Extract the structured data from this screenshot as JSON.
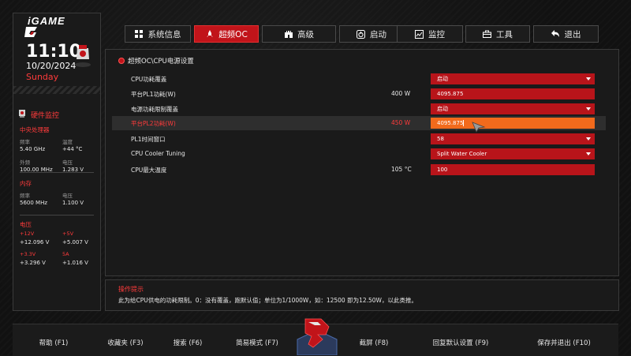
{
  "brand": "iGAME",
  "clock": {
    "time": "11:10",
    "date": "10/20/2024",
    "weekday": "Sunday"
  },
  "hardware": {
    "title": "硬件监控",
    "cpu": {
      "title": "中央处理器",
      "freq_label": "频率",
      "freq": "5.40 GHz",
      "temp_label": "温度",
      "temp": "+44 °C",
      "ext_freq_label": "外频",
      "ext_freq": "100.00 MHz",
      "voltage_label": "电压",
      "voltage": "1.283 V"
    },
    "memory": {
      "title": "内存",
      "freq_label": "频率",
      "freq": "5600 MHz",
      "voltage_label": "电压",
      "voltage": "1.100 V"
    },
    "power": {
      "title": "电压",
      "v12_label": "+12V",
      "v12": "+12.096 V",
      "v5_label": "+5V",
      "v5": "+5.007 V",
      "v33_label": "+3.3V",
      "v33": "+3.296 V",
      "v5sb_label": "5A",
      "v5sb": "+1.016 V"
    }
  },
  "tabs": [
    {
      "label": "系统信息",
      "icon": "grid-icon"
    },
    {
      "label": "超频OC",
      "icon": "rocket-icon",
      "active": true
    },
    {
      "label": "高级",
      "icon": "castle-icon"
    },
    {
      "label": "启动",
      "icon": "power-icon"
    },
    {
      "label": "监控",
      "icon": "chart-icon"
    },
    {
      "label": "工具",
      "icon": "toolbox-icon"
    },
    {
      "label": "退出",
      "icon": "return-icon"
    }
  ],
  "breadcrumb": "超频OC\\CPU电源设置",
  "settings": [
    {
      "label": "CPU功耗覆盖",
      "mid": "",
      "value": "启动",
      "dropdown": true
    },
    {
      "label": "平台PL1功耗(W)",
      "mid": "400 W",
      "value": "4095.875",
      "dropdown": false
    },
    {
      "label": "电源功耗限制覆盖",
      "mid": "",
      "value": "启动",
      "dropdown": true
    },
    {
      "label": "平台PL2功耗(W)",
      "mid": "450 W",
      "value": "4095.875",
      "dropdown": false,
      "selected": true
    },
    {
      "label": "PL1时间窗口",
      "mid": "",
      "value": "58",
      "dropdown": true
    },
    {
      "label": "CPU Cooler Tuning",
      "mid": "",
      "value": "Split Water Cooler",
      "dropdown": true
    },
    {
      "label": "CPU最大温度",
      "mid": "105 °C",
      "value": "100",
      "dropdown": false
    }
  ],
  "help": {
    "title": "操作提示",
    "text": "此为给CPU供电的功耗限制。0：没有覆盖，跑默认值；单位为1/1000W，如：12500 即为12.50W，以此类推。"
  },
  "function_keys": [
    {
      "label": "帮助 (F1)"
    },
    {
      "label": "收藏夹 (F3)"
    },
    {
      "label": "搜索 (F6)"
    },
    {
      "label": "简易模式 (F7)"
    },
    {
      "label": "截屏 (F8)"
    },
    {
      "label": "回复默认设置 (F9)"
    },
    {
      "label": "保存并退出 (F10)"
    }
  ],
  "colors": {
    "accent": "#c1141a",
    "highlight": "#f26a1c",
    "label_red": "#ff3b3b"
  }
}
